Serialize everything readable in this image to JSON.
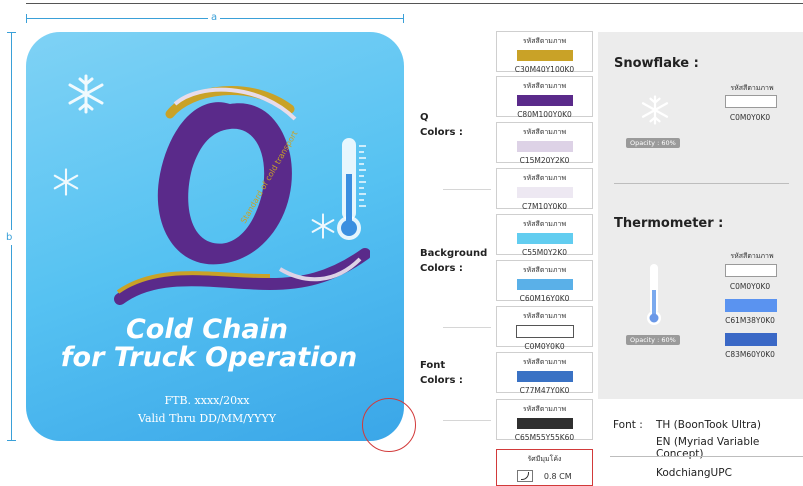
{
  "dimensions": {
    "width_label": "a",
    "height_label": "b"
  },
  "card": {
    "logo_letter": "Q",
    "logo_ribbon_text": "Standard of cold transport",
    "title_line1": "Cold Chain",
    "title_line2": "for Truck Operation",
    "ftb": "FTB. xxxx/20xx",
    "valid": "Valid Thru DD/MM/YYYY"
  },
  "groups": {
    "q_colors": "Q\nColors :",
    "background_colors": "Background\nColors :",
    "font_colors": "Font\nColors :"
  },
  "swatch_label": "รหัสสีตามภาพ",
  "swatches": [
    {
      "code": "C30M40Y100K0",
      "color": "#c9a227"
    },
    {
      "code": "C80M100Y0K0",
      "color": "#5a2a8a"
    },
    {
      "code": "C15M20Y2K0",
      "color": "#ddd2e6"
    },
    {
      "code": "C7M10Y0K0",
      "color": "#ede8f2"
    },
    {
      "code": "C55M0Y2K0",
      "color": "#62cdf0"
    },
    {
      "code": "C60M16Y0K0",
      "color": "#5ab0e8"
    },
    {
      "code": "C0M0Y0K0",
      "color": "#ffffff"
    },
    {
      "code": "C77M47Y0K0",
      "color": "#3a72c4"
    },
    {
      "code": "C65M55Y55K60",
      "color": "#2f2f2f"
    }
  ],
  "corner": {
    "label": "รัศมีมุมโค้ง",
    "value": "0.8 CM"
  },
  "snowflake": {
    "title": "Snowflake :",
    "code_label": "รหัสสีตามภาพ",
    "code": "C0M0Y0K0",
    "opacity": "Opacity : 60%"
  },
  "thermometer": {
    "title": "Thermometer :",
    "code_label": "รหัสสีตามภาพ",
    "codes": [
      {
        "code": "C0M0Y0K0",
        "color": "#ffffff"
      },
      {
        "code": "C61M38Y0K0",
        "color": "#5a93f0"
      },
      {
        "code": "C83M60Y0K0",
        "color": "#3a68c6"
      }
    ],
    "opacity": "Opacity : 60%"
  },
  "font_info": {
    "label": "Font :",
    "line1": "TH (BoonTook Ultra)",
    "line2": "EN (Myriad Variable Concept)",
    "line3": "KodchiangUPC"
  }
}
